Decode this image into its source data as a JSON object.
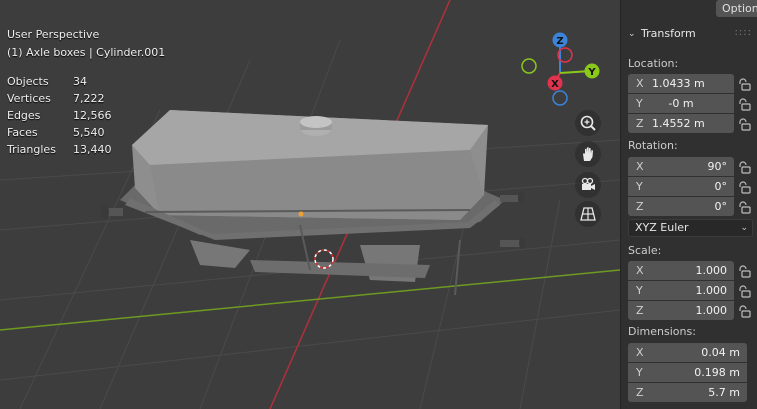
{
  "viewport": {
    "view_name": "User Perspective",
    "active_object": "(1) Axle boxes | Cylinder.001",
    "stats": [
      {
        "label": "Objects",
        "value": "34"
      },
      {
        "label": "Vertices",
        "value": "7,222"
      },
      {
        "label": "Edges",
        "value": "12,566"
      },
      {
        "label": "Faces",
        "value": "5,540"
      },
      {
        "label": "Triangles",
        "value": "13,440"
      }
    ],
    "gizmo": {
      "z": "Z",
      "y": "Y",
      "x": "X"
    },
    "colors": {
      "x_axis": "#e0344e",
      "y_axis": "#8ac81a",
      "z_axis": "#3b84d9",
      "x_line": "#b0303a",
      "y_line": "#6e9a22"
    }
  },
  "sidebar": {
    "options_tab": "Options",
    "panel_title": "Transform",
    "location": {
      "label": "Location:",
      "x": {
        "axis": "X",
        "value": "1.0433 m"
      },
      "y": {
        "axis": "Y",
        "value": "-0 m"
      },
      "z": {
        "axis": "Z",
        "value": "1.4552 m"
      }
    },
    "rotation": {
      "label": "Rotation:",
      "x": {
        "axis": "X",
        "value": "90°"
      },
      "y": {
        "axis": "Y",
        "value": "0°"
      },
      "z": {
        "axis": "Z",
        "value": "0°"
      },
      "mode": "XYZ Euler"
    },
    "scale": {
      "label": "Scale:",
      "x": {
        "axis": "X",
        "value": "1.000"
      },
      "y": {
        "axis": "Y",
        "value": "1.000"
      },
      "z": {
        "axis": "Z",
        "value": "1.000"
      }
    },
    "dimensions": {
      "label": "Dimensions:",
      "x": {
        "axis": "X",
        "value": "0.04 m"
      },
      "y": {
        "axis": "Y",
        "value": "0.198 m"
      },
      "z": {
        "axis": "Z",
        "value": "5.7 m"
      }
    }
  }
}
